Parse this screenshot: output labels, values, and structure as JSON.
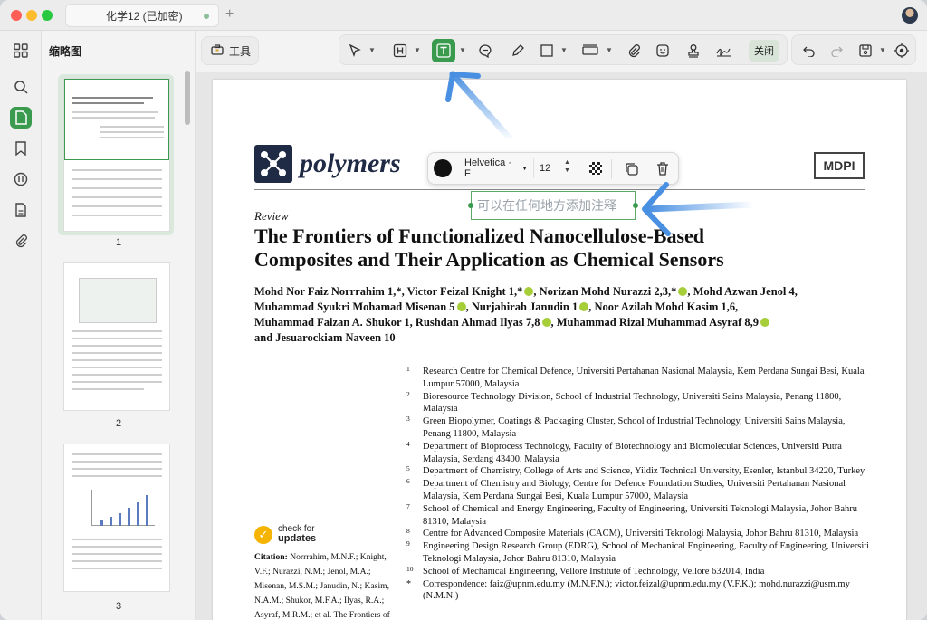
{
  "window": {
    "tab_title": "化学12 (已加密)",
    "new_tab_symbol": "+"
  },
  "sidebar": {
    "panel_title": "缩略图",
    "thumbnails": [
      {
        "page": "1"
      },
      {
        "page": "2"
      },
      {
        "page": "3"
      }
    ]
  },
  "toolbar": {
    "tools_label": "工具",
    "close_label": "关闭"
  },
  "popover": {
    "font": "Helvetica · F",
    "size": "12",
    "color": "#111111"
  },
  "annotation": {
    "placeholder": "可以在任何地方添加注释"
  },
  "document": {
    "journal": "polymers",
    "publisher": "MDPI",
    "article_type": "Review",
    "title_line1": "The Frontiers of Functionalized Nanocellulose-Based",
    "title_line2": "Composites and Their Application as Chemical Sensors",
    "authors": [
      "Mohd Nor Faiz Norrrahim 1,*, Victor Feizal Knight 1,*",
      ", Norizan Mohd Nurazzi 2,3,*",
      ", Mohd Azwan Jenol 4,",
      "Muhammad Syukri Mohamad Misenan 5",
      ", Nurjahirah Janudin 1",
      ", Noor Azilah Mohd Kasim 1,6,",
      "Muhammad Faizan A. Shukor 1, Rushdan Ahmad Ilyas 7,8",
      ", Muhammad Rizal Muhammad Asyraf 8,9",
      "and Jesuarockiam Naveen 10"
    ],
    "affiliations": [
      {
        "n": "1",
        "text": "Research Centre for Chemical Defence, Universiti Pertahanan Nasional Malaysia, Kem Perdana Sungai Besi, Kuala Lumpur 57000, Malaysia"
      },
      {
        "n": "2",
        "text": "Bioresource Technology Division, School of Industrial Technology, Universiti Sains Malaysia, Penang 11800, Malaysia"
      },
      {
        "n": "3",
        "text": "Green Biopolymer, Coatings & Packaging Cluster, School of Industrial Technology, Universiti Sains Malaysia, Penang 11800, Malaysia"
      },
      {
        "n": "4",
        "text": "Department of Bioprocess Technology, Faculty of Biotechnology and Biomolecular Sciences, Universiti Putra Malaysia, Serdang 43400, Malaysia"
      },
      {
        "n": "5",
        "text": "Department of Chemistry, College of Arts and Science, Yildiz Technical University, Esenler, Istanbul 34220, Turkey"
      },
      {
        "n": "6",
        "text": "Department of Chemistry and Biology, Centre for Defence Foundation Studies, Universiti Pertahanan Nasional Malaysia, Kem Perdana Sungai Besi, Kuala Lumpur 57000, Malaysia"
      },
      {
        "n": "7",
        "text": "School of Chemical and Energy Engineering, Faculty of Engineering, Universiti Teknologi Malaysia, Johor Bahru 81310, Malaysia"
      },
      {
        "n": "8",
        "text": "Centre for Advanced Composite Materials (CACM), Universiti Teknologi Malaysia, Johor Bahru 81310, Malaysia"
      },
      {
        "n": "9",
        "text": "Engineering Design Research Group (EDRG), School of Mechanical Engineering, Faculty of Engineering, Universiti Teknologi Malaysia, Johor Bahru 81310, Malaysia"
      },
      {
        "n": "10",
        "text": "School of Mechanical Engineering, Vellore Institute of Technology, Vellore 632014, India"
      },
      {
        "n": "*",
        "text": "Correspondence: faiz@upnm.edu.my (M.N.F.N.); victor.feizal@upnm.edu.my (V.F.K.); mohd.nurazzi@usm.my (N.M.N.)"
      }
    ],
    "check_updates_line1": "check for",
    "check_updates_line2": "updates",
    "citation_label": "Citation:",
    "citation_text": "Norrrahim, M.N.F.; Knight, V.F.; Nurazzi, N.M.; Jenol, M.A.; Misenan, M.S.M.; Janudin, N.; Kasim, N.A.M.; Shukor, M.F.A.; Ilyas, R.A.; Asyraf, M.R.M.; et al. The Frontiers of"
  },
  "colors": {
    "accent": "#3a9a4e",
    "arrow": "#4a90e2"
  }
}
